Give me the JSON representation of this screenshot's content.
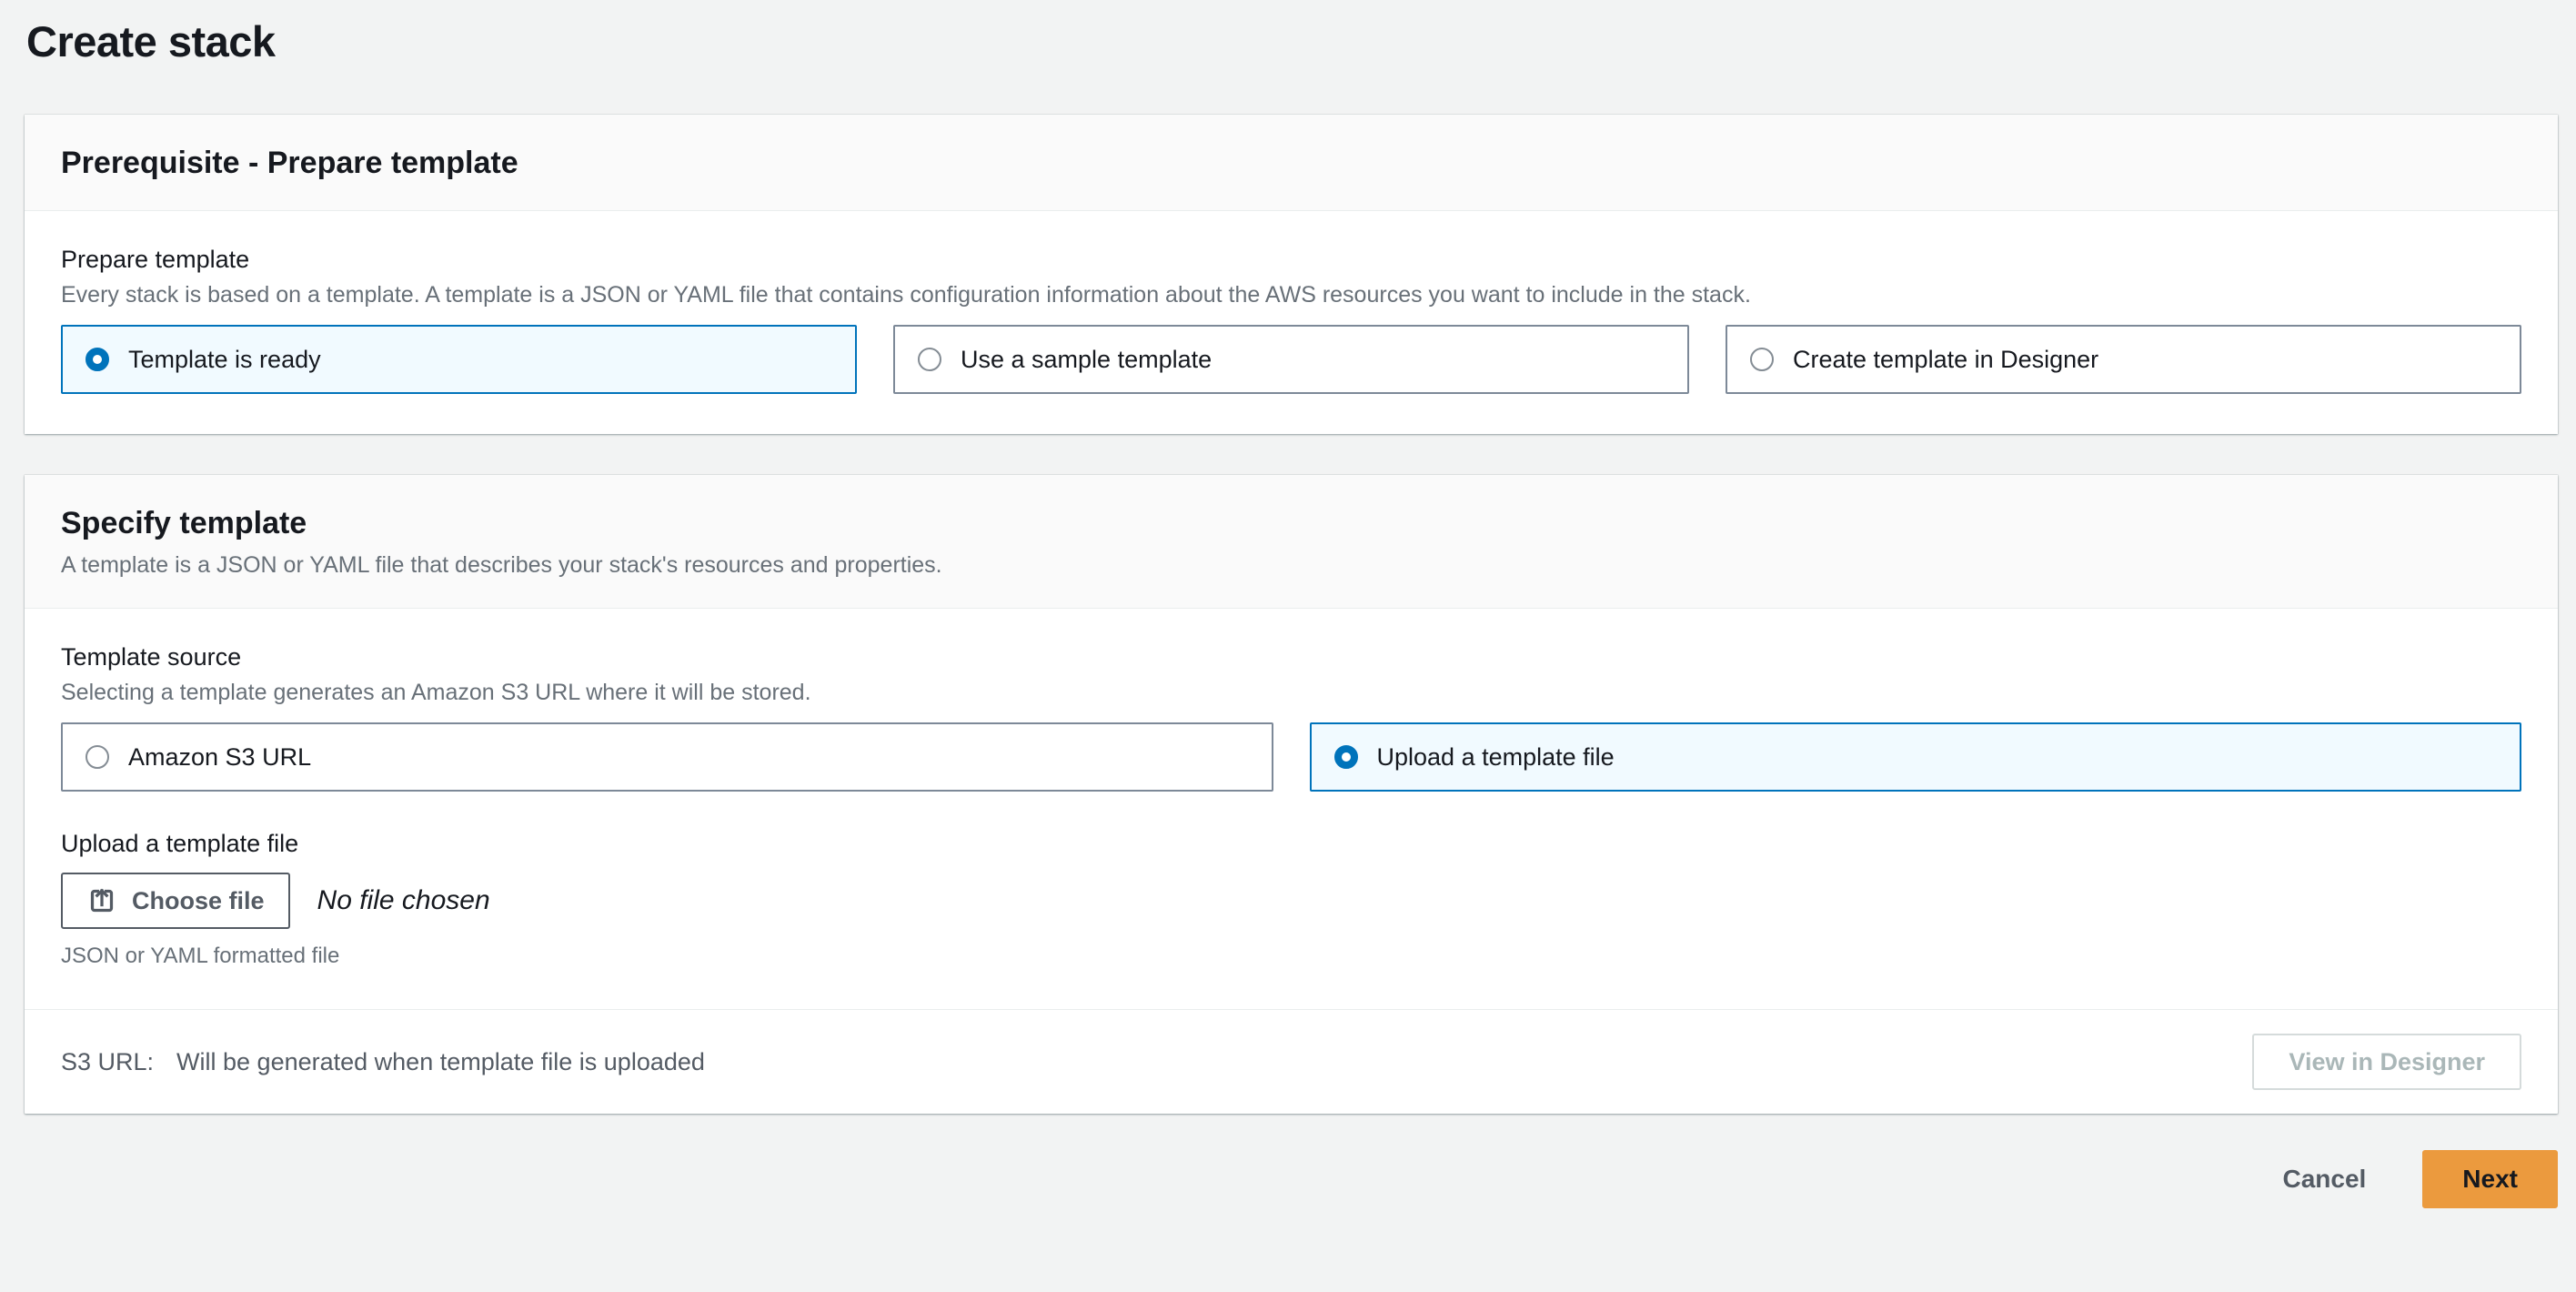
{
  "page": {
    "title": "Create stack"
  },
  "colors": {
    "page_background": "#f2f3f3",
    "accent_blue": "#0073bb",
    "selected_tile_background": "#f1faff",
    "next_button_orange": "#eb9a3e",
    "secondary_text": "#687078"
  },
  "prerequisite_panel": {
    "title": "Prerequisite - Prepare template",
    "field_label": "Prepare template",
    "field_description": "Every stack is based on a template. A template is a JSON or YAML file that contains configuration information about the AWS resources you want to include in the stack.",
    "options": [
      {
        "label": "Template is ready",
        "selected": true
      },
      {
        "label": "Use a sample template",
        "selected": false
      },
      {
        "label": "Create template in Designer",
        "selected": false
      }
    ]
  },
  "specify_panel": {
    "title": "Specify template",
    "description": "A template is a JSON or YAML file that describes your stack's resources and properties.",
    "source_label": "Template source",
    "source_description": "Selecting a template generates an Amazon S3 URL where it will be stored.",
    "source_options": [
      {
        "label": "Amazon S3 URL",
        "selected": false
      },
      {
        "label": "Upload a template file",
        "selected": true
      }
    ],
    "upload_label": "Upload a template file",
    "choose_file_label": "Choose file",
    "no_file_text": "No file chosen",
    "file_hint": "JSON or YAML formatted file",
    "s3_label": "S3 URL:",
    "s3_value": "Will be generated when template file is uploaded",
    "view_designer_label": "View in Designer"
  },
  "actions": {
    "cancel_label": "Cancel",
    "next_label": "Next"
  }
}
